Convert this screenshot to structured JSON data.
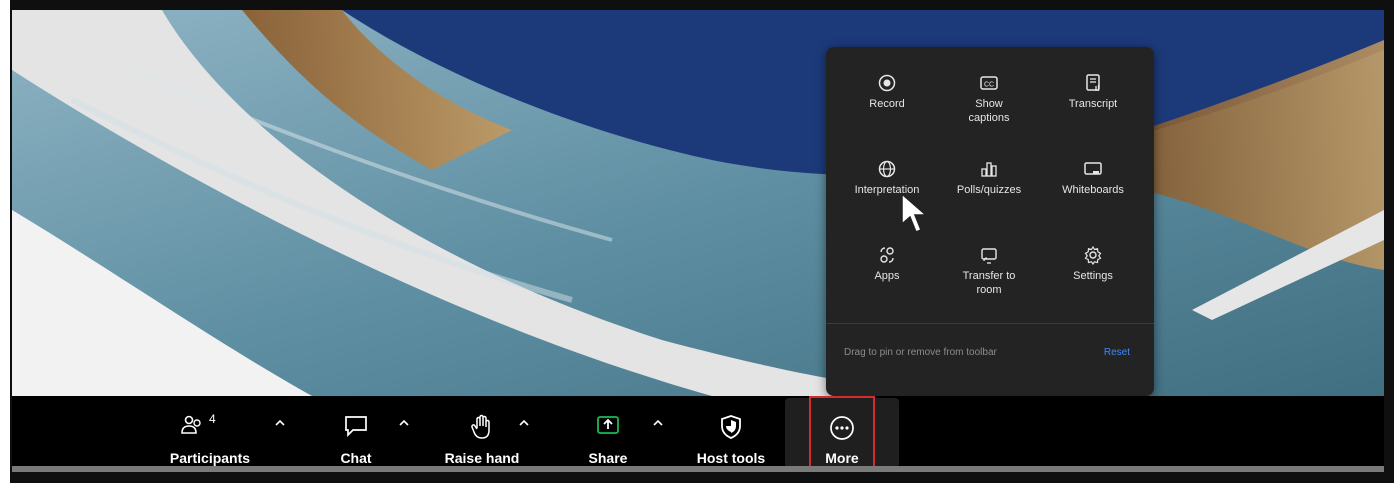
{
  "more_menu": {
    "items": [
      {
        "label": "Record",
        "icon": "record-icon"
      },
      {
        "label": "Show captions",
        "icon": "captions-icon"
      },
      {
        "label": "Transcript",
        "icon": "transcript-icon"
      },
      {
        "label": "Interpretation",
        "icon": "globe-icon"
      },
      {
        "label": "Polls/quizzes",
        "icon": "polls-icon"
      },
      {
        "label": "Whiteboards",
        "icon": "whiteboard-icon"
      },
      {
        "label": "Apps",
        "icon": "apps-icon"
      },
      {
        "label": "Transfer to room",
        "icon": "transfer-icon"
      },
      {
        "label": "Settings",
        "icon": "gear-icon"
      }
    ],
    "footer_text": "Drag to pin or remove from toolbar",
    "reset_label": "Reset"
  },
  "toolbar": {
    "participants_label": "Participants",
    "participants_count": "4",
    "chat_label": "Chat",
    "raise_hand_label": "Raise hand",
    "share_label": "Share",
    "host_tools_label": "Host tools",
    "more_label": "More"
  },
  "colors": {
    "accent_share": "#1db954",
    "highlight": "#d62b2b",
    "link": "#3d8bff",
    "panel_bg": "#232323"
  }
}
